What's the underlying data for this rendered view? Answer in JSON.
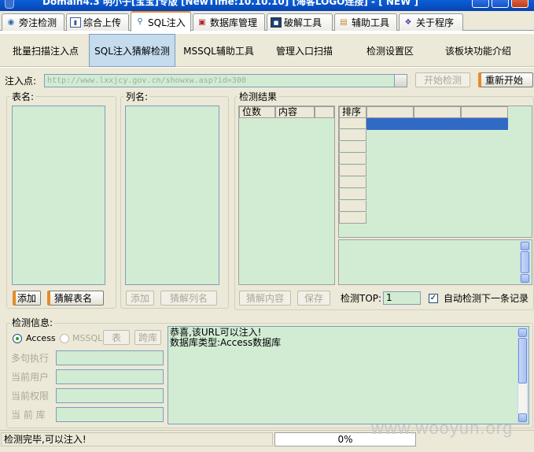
{
  "window": {
    "title": "Domain4.3 明小子[宝宝]专版 [NewTime:10.10.10] [海客LOGO连接]  - [ NEW ]"
  },
  "main_tabs": [
    {
      "label": "旁注检测",
      "icon": "magnifier-icon"
    },
    {
      "label": "综合上传",
      "icon": "upload-chart-icon"
    },
    {
      "label": "SQL注入",
      "icon": "search-icon",
      "active": true
    },
    {
      "label": "数据库管理",
      "icon": "database-icon"
    },
    {
      "label": "破解工具",
      "icon": "crack-tool-icon"
    },
    {
      "label": "辅助工具",
      "icon": "clipboard-icon"
    },
    {
      "label": "关于程序",
      "icon": "about-icon"
    }
  ],
  "sub_tabs": [
    {
      "label": "批量扫描注入点"
    },
    {
      "label": "SQL注入猜解检测",
      "active": true
    },
    {
      "label": "MSSQL辅助工具"
    },
    {
      "label": "管理入口扫描"
    },
    {
      "label": "检测设置区"
    },
    {
      "label": "该板块功能介绍"
    }
  ],
  "injection": {
    "label": "注入点:",
    "url": "http://www.lxxjcy.gov.cn/showxw.asp?id=300",
    "start_button": "开始检测",
    "restart_button": "重新开始"
  },
  "tables": {
    "label": "表名:",
    "add_button": "添加",
    "guess_button": "猜解表名"
  },
  "columns": {
    "label": "列名:",
    "add_button": "添加",
    "guess_button": "猜解列名"
  },
  "results": {
    "label": "检测结果",
    "col_digits": "位数",
    "col_content": "内容",
    "sort_header": "排序",
    "guess_content_button": "猜解内容",
    "save_button": "保存",
    "top_label": "检测TOP:",
    "top_value": "1",
    "auto_check_label": "自动检测下一条记录",
    "auto_check_checked": true
  },
  "info": {
    "label": "检测信息:",
    "db_access": "Access",
    "db_mssql": "MSSQL",
    "table_button": "表",
    "cross_db_button": "跨库",
    "multi_exec_label": "多句执行",
    "current_user_label": "当前用户",
    "current_perm_label": "当前权限",
    "current_db_label": "当 前 库",
    "log": "恭喜,该URL可以注入!\n数据库类型:Access数据库"
  },
  "status": {
    "message": "检测完毕,可以注入!",
    "progress": "0%"
  },
  "watermark": "www.wooyun.org",
  "colors": {
    "field_green": "#d1ecd3",
    "selection_blue": "#316ac5",
    "accent_orange": "#e38b2b",
    "titlebar_blue": "#0a5fd8"
  }
}
